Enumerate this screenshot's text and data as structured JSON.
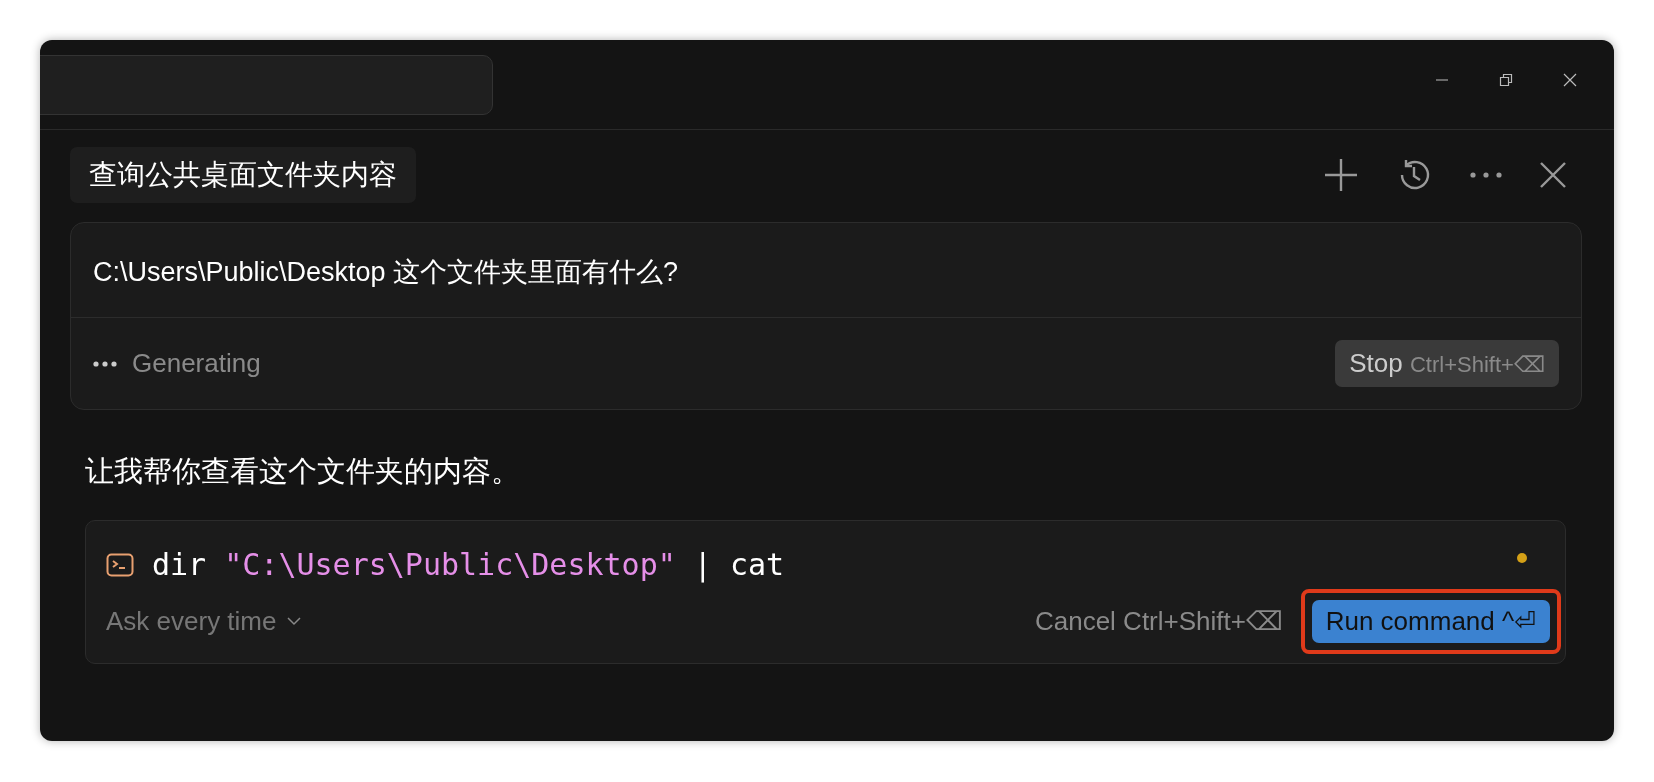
{
  "chat": {
    "title": "查询公共桌面文件夹内容"
  },
  "prompt": {
    "text": "C:\\Users\\Public\\Desktop 这个文件夹里面有什么?",
    "status": "Generating",
    "stop_button": {
      "label": "Stop",
      "shortcut": "Ctrl+Shift+⌫"
    }
  },
  "reply": {
    "text": "让我帮你查看这个文件夹的内容。"
  },
  "command": {
    "segments": [
      {
        "kind": "plain",
        "text": "dir "
      },
      {
        "kind": "string",
        "text": "\"C:\\Users\\Public\\Desktop\""
      },
      {
        "kind": "plain",
        "text": " | "
      },
      {
        "kind": "plain",
        "text": "cat"
      }
    ],
    "pending": true,
    "approval_mode": "Ask every time",
    "cancel": {
      "label": "Cancel",
      "shortcut": "Ctrl+Shift+⌫"
    },
    "run_button": {
      "label": "Run command",
      "shortcut": "^⏎",
      "highlighted": true
    }
  }
}
